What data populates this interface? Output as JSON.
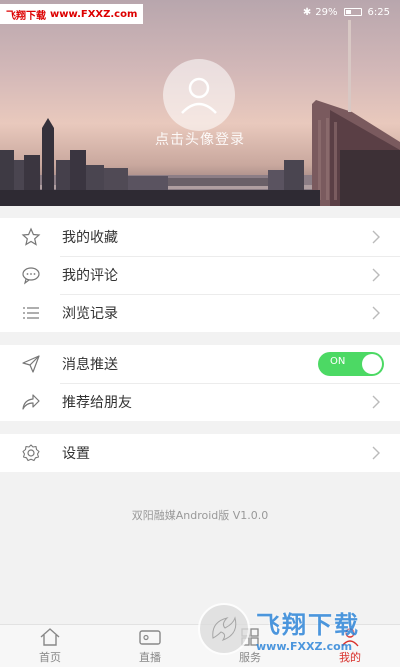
{
  "watermark_top": {
    "brand": "飞翔下载",
    "url": "www.FXXZ.com"
  },
  "status_bar": {
    "bluetooth_icon": "bluetooth-icon",
    "battery_percent": "29%",
    "time": "6:25"
  },
  "profile": {
    "login_hint": "点击头像登录"
  },
  "menu_group_1": [
    {
      "label": "我的收藏",
      "icon": "star-icon"
    },
    {
      "label": "我的评论",
      "icon": "comment-icon"
    },
    {
      "label": "浏览记录",
      "icon": "list-icon"
    }
  ],
  "menu_group_2": [
    {
      "label": "消息推送",
      "icon": "send-icon",
      "toggle": "ON"
    },
    {
      "label": "推荐给朋友",
      "icon": "share-icon"
    }
  ],
  "menu_group_3": [
    {
      "label": "设置",
      "icon": "gear-icon"
    }
  ],
  "version": "双阳融媒Android版 V1.0.0",
  "tabs": [
    {
      "label": "首页",
      "icon": "home-icon"
    },
    {
      "label": "直播",
      "icon": "video-icon"
    },
    {
      "label": "服务",
      "icon": "grid-icon"
    },
    {
      "label": "我的",
      "icon": "user-icon",
      "active": true
    }
  ],
  "watermark_bottom": {
    "big": "飞翔下载",
    "small": "www.FXXZ.com"
  },
  "colors": {
    "toggle_on": "#4cd964",
    "active_tab": "#d9302b"
  }
}
